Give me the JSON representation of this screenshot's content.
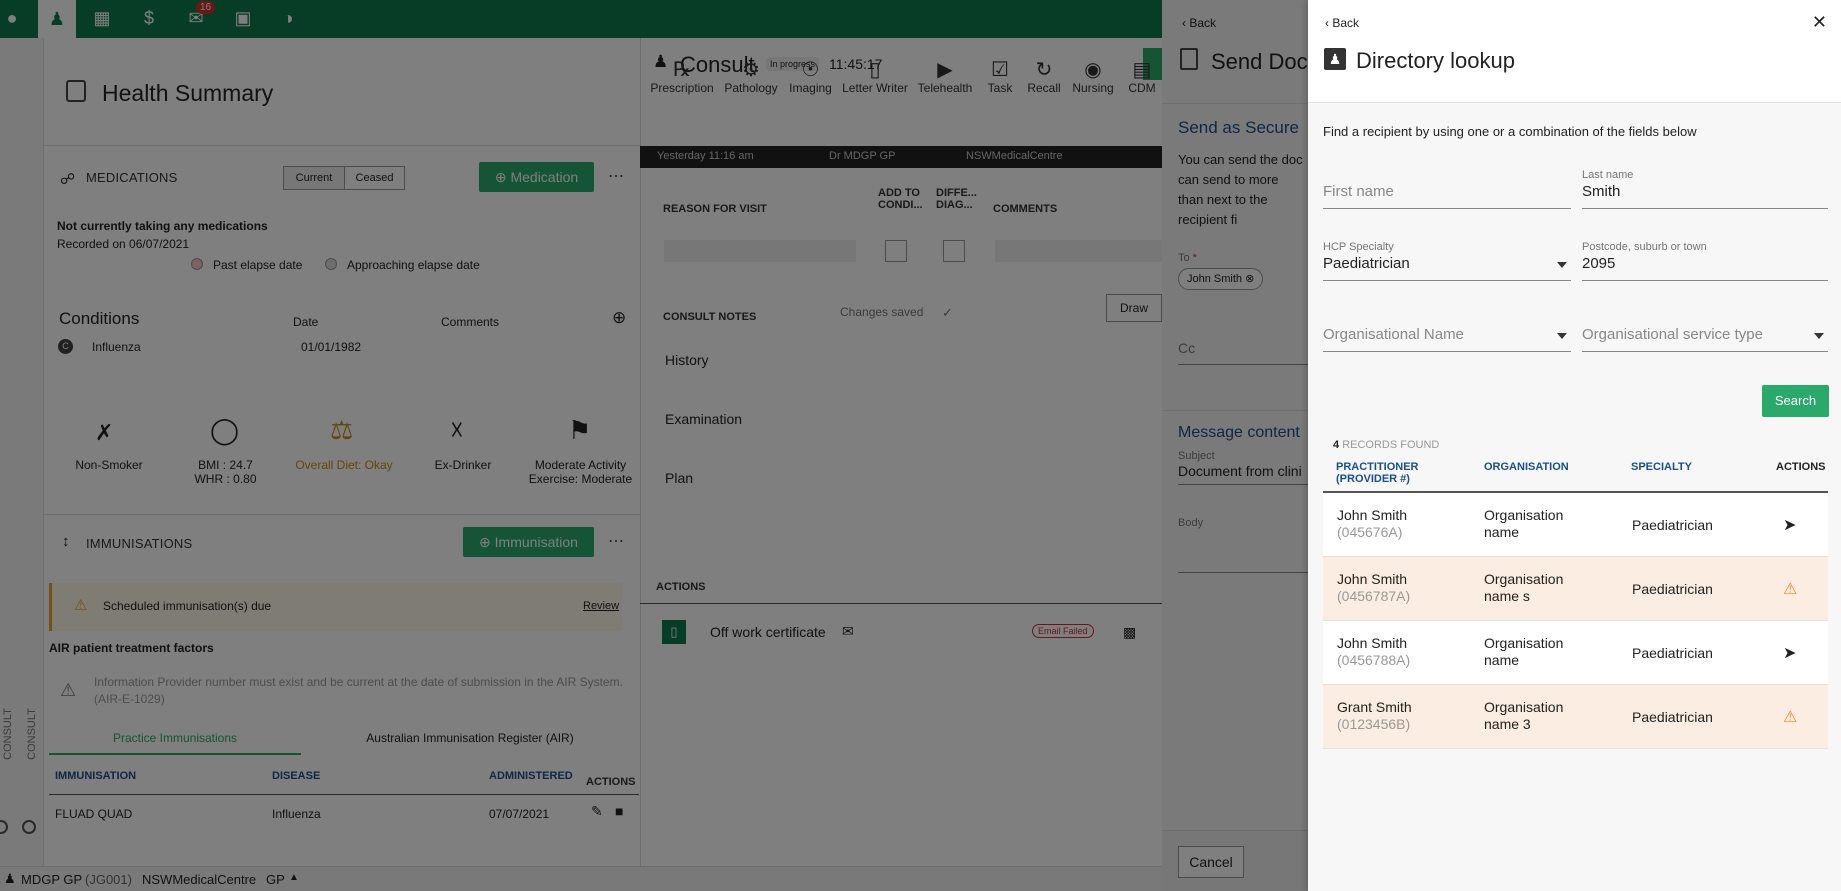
{
  "topnav": {
    "badge": "16"
  },
  "health": {
    "title": "Health Summary",
    "medications": {
      "title": "MEDICATIONS",
      "seg_current": "Current",
      "seg_ceased": "Ceased",
      "add_button": "Medication",
      "status": "Not currently taking any medications",
      "recorded": "Recorded on 06/07/2021",
      "legend_past": "Past elapse date",
      "legend_approaching": "Approaching elapse date"
    },
    "conditions": {
      "title": "Conditions",
      "col_date": "Date",
      "col_comments": "Comments",
      "row_name": "Influenza",
      "row_date": "01/01/1982"
    },
    "lifestyle": [
      {
        "label": "Non-Smoker",
        "sub": ""
      },
      {
        "label": "BMI : 24.7",
        "sub": "WHR : 0.80"
      },
      {
        "label": "Overall Diet: Okay",
        "sub": ""
      },
      {
        "label": "Ex-Drinker",
        "sub": ""
      },
      {
        "label": "Moderate Activity",
        "sub": "Exercise: Moderate"
      }
    ],
    "immunisations": {
      "title": "IMMUNISATIONS",
      "add_button": "Immunisation",
      "due": "Scheduled immunisation(s) due",
      "review": "Review",
      "air_title": "AIR patient treatment factors",
      "air_msg": "Information Provider number must exist and be current at the date of submission in the AIR System. (AIR-E-1029)",
      "tab_practice": "Practice Immunisations",
      "tab_air": "Australian Immunisation Register (AIR)",
      "cols": [
        "IMMUNISATION",
        "DISEASE",
        "ADMINISTERED",
        "ACTIONS"
      ],
      "row": [
        "FLUAD QUAD",
        "Influenza",
        "07/07/2021"
      ]
    }
  },
  "side_labels": [
    "CONSULT",
    "CONSULT"
  ],
  "consult": {
    "title": "Consult",
    "status": "In progress",
    "time": "11:45:17",
    "tools": [
      "Prescription",
      "Pathology",
      "Imaging",
      "Letter Writer",
      "Telehealth",
      "Task",
      "Recall",
      "Nursing",
      "CDM"
    ],
    "bar": [
      "Yesterday 11:16 am",
      "Dr MDGP GP",
      "NSWMedicalCentre"
    ],
    "cols": [
      "REASON FOR VISIT",
      "ADD TO CONDI...",
      "DIFFE... DIAG...",
      "COMMENTS"
    ],
    "notes_title": "CONSULT NOTES",
    "changes_saved": "Changes saved",
    "draw": "Draw",
    "notes": [
      "History",
      "Examination",
      "Plan"
    ],
    "actions_title": "ACTIONS",
    "action_item": "Off work certificate",
    "email_failed": "Email Failed"
  },
  "senddoc": {
    "back": "Back",
    "title": "Send Doc",
    "section": "Send as Secure",
    "desc": "You can send the doc can send to more than next to the recipient fi",
    "to_label": "To",
    "to_chip": "John Smith",
    "cc_label": "Cc",
    "msg_title": "Message content",
    "subject_label": "Subject",
    "subject_val": "Document from clini",
    "body_label": "Body",
    "cancel": "Cancel"
  },
  "footer": {
    "user": "MDGP GP",
    "code": "(JG001)",
    "centre": "NSWMedicalCentre",
    "role": "GP"
  },
  "directory": {
    "back": "Back",
    "title": "Directory lookup",
    "intro": "Find a recipient by using one or a combination of the fields below",
    "first_name_ph": "First name",
    "last_name_label": "Last name",
    "last_name_val": "Smith",
    "specialty_label": "HCP Specialty",
    "specialty_val": "Paediatrician",
    "postcode_label": "Postcode, suburb or town",
    "postcode_val": "2095",
    "org_name_ph": "Organisational Name",
    "org_type_ph": "Organisational service type",
    "search": "Search",
    "records_count": "4",
    "records_label": "RECORDS FOUND",
    "cols": [
      "PRACTITIONER (PROVIDER #)",
      "ORGANISATION",
      "SPECIALTY",
      "ACTIONS"
    ],
    "rows": [
      {
        "name": "John Smith",
        "provider": "(045676A)",
        "org": "Organisation name",
        "specialty": "Paediatrician",
        "action": "send-icon"
      },
      {
        "name": "John Smith",
        "provider": "(0456787A)",
        "org": "Organisation name s",
        "specialty": "Paediatrician",
        "action": "warning-icon"
      },
      {
        "name": "John Smith",
        "provider": "(0456788A)",
        "org": "Organisation name",
        "specialty": "Paediatrician",
        "action": "send-icon"
      },
      {
        "name": "Grant Smith",
        "provider": "(0123456B)",
        "org": "Organisation name 3",
        "specialty": "Paediatrician",
        "action": "warning-icon"
      }
    ]
  }
}
